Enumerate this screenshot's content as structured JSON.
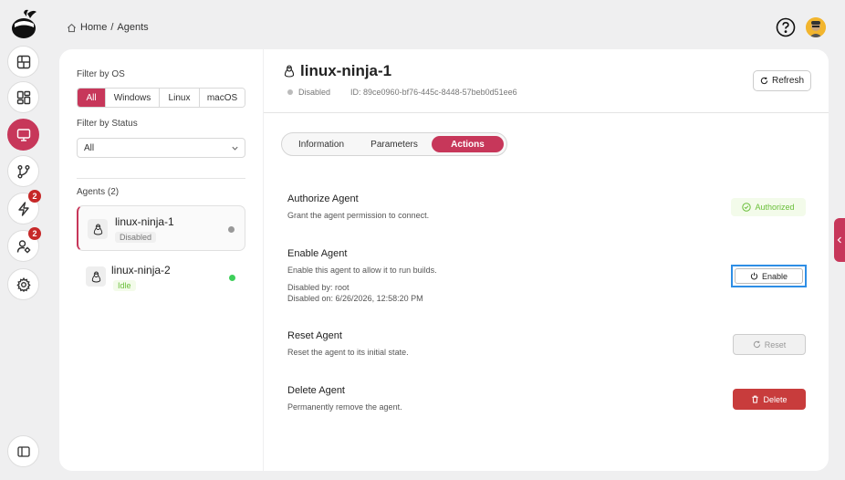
{
  "breadcrumb": {
    "home": "Home",
    "separator": "/",
    "current": "Agents"
  },
  "rail": {
    "items": [
      {
        "name": "dashboard",
        "icon": "layout-icon"
      },
      {
        "name": "grid",
        "icon": "grid-icon"
      },
      {
        "name": "agents",
        "icon": "monitor-icon",
        "active": true
      },
      {
        "name": "branches",
        "icon": "git-branch-icon"
      },
      {
        "name": "events",
        "icon": "lightning-icon",
        "badge": "2"
      },
      {
        "name": "users",
        "icon": "user-settings-icon",
        "badge": "2"
      },
      {
        "name": "settings",
        "icon": "gear-icon"
      }
    ]
  },
  "filters": {
    "os_label": "Filter by OS",
    "os_options": [
      "All",
      "Windows",
      "Linux",
      "macOS"
    ],
    "status_label": "Filter by Status",
    "status_value": "All"
  },
  "agents": {
    "heading": "Agents (2)",
    "list": [
      {
        "name": "linux-ninja-1",
        "status": "Disabled"
      },
      {
        "name": "linux-ninja-2",
        "status": "Idle"
      }
    ]
  },
  "detail": {
    "title": "linux-ninja-1",
    "status": "Disabled",
    "id": "ID: 89ce0960-bf76-445c-8448-57beb0d51ee6",
    "refresh_label": "Refresh",
    "tabs": [
      "Information",
      "Parameters",
      "Actions"
    ],
    "actions": {
      "authorize": {
        "title": "Authorize Agent",
        "desc": "Grant the agent permission to connect.",
        "badge": "Authorized"
      },
      "enable": {
        "title": "Enable Agent",
        "desc": "Enable this agent to allow it to run builds.",
        "disabled_by": "Disabled by: root",
        "disabled_on": "Disabled on: 6/26/2026, 12:58:20 PM",
        "button": "Enable"
      },
      "reset": {
        "title": "Reset Agent",
        "desc": "Reset the agent to its initial state.",
        "button": "Reset"
      },
      "delete": {
        "title": "Delete Agent",
        "desc": "Permanently remove the agent.",
        "button": "Delete"
      }
    }
  },
  "colors": {
    "accent": "#c7375a",
    "success": "#6abf3a",
    "danger": "#c83c3c",
    "focus": "#2e8ee5"
  }
}
